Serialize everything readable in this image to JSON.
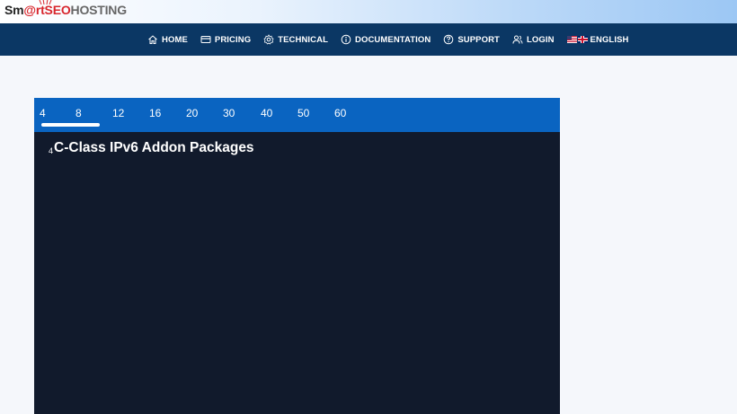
{
  "brand": {
    "part1": "Sm",
    "part2": "@",
    "part3": "rtSEO",
    "part4": "HOSTING",
    "accent": "#d8262d"
  },
  "nav": {
    "items": [
      {
        "label": "HOME",
        "icon": "home-icon"
      },
      {
        "label": "PRICING",
        "icon": "credit-card-icon"
      },
      {
        "label": "TECHNICAL",
        "icon": "gear-icon"
      },
      {
        "label": "DOCUMENTATION",
        "icon": "info-icon"
      },
      {
        "label": "SUPPORT",
        "icon": "question-icon"
      },
      {
        "label": "LOGIN",
        "icon": "users-icon"
      },
      {
        "label": "ENGLISH",
        "icon": "flag-icon"
      }
    ]
  },
  "tabs": [
    "4",
    "8",
    "12",
    "16",
    "20",
    "30",
    "40",
    "50",
    "60"
  ],
  "active_tab": "4",
  "content": {
    "prefix": "4",
    "title": "C-Class IPv6 Addon Packages"
  },
  "colors": {
    "nav_bg": "#0b3764",
    "tabs_bg": "#0a64c1",
    "panel_bg": "#111a2c"
  }
}
